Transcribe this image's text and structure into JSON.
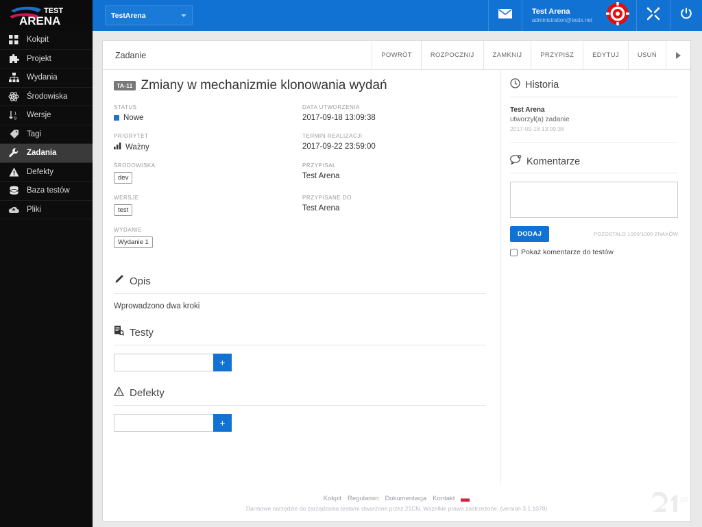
{
  "brand": {
    "logo_top": "TEST",
    "logo_bottom": "ARENA"
  },
  "colors": {
    "accent": "#1272d3",
    "sidebar_bg": "#0d0d0d",
    "status_blue": "#1e73c8",
    "badge_gray": "#777777"
  },
  "topbar": {
    "project_select": "TestArena",
    "user_name": "Test Arena",
    "user_email": "administration@testx.net",
    "icons": [
      "mail-icon",
      "brand-target-icon",
      "tools-icon",
      "power-icon"
    ]
  },
  "sidebar": {
    "items": [
      {
        "label": "Kokpit",
        "icon": "dashboard-icon",
        "active": false
      },
      {
        "label": "Projekt",
        "icon": "puzzle-icon",
        "active": false
      },
      {
        "label": "Wydania",
        "icon": "sitemap-icon",
        "active": false
      },
      {
        "label": "Środowiska",
        "icon": "atom-icon",
        "active": false
      },
      {
        "label": "Wersje",
        "icon": "sort-numeric-icon",
        "active": false
      },
      {
        "label": "Tagi",
        "icon": "tag-icon",
        "active": false
      },
      {
        "label": "Zadania",
        "icon": "wrench-icon",
        "active": true
      },
      {
        "label": "Defekty",
        "icon": "warning-icon",
        "active": false
      },
      {
        "label": "Baza testów",
        "icon": "database-icon",
        "active": false
      },
      {
        "label": "Pliki",
        "icon": "cloud-icon",
        "active": false
      }
    ]
  },
  "action_bar": {
    "title": "Zadanie",
    "buttons": [
      {
        "label": "POWRÓT",
        "name": "back-button"
      },
      {
        "label": "ROZPOCZNIJ",
        "name": "start-button"
      },
      {
        "label": "ZAMKNIJ",
        "name": "close-button"
      },
      {
        "label": "PRZYPISZ",
        "name": "assign-button"
      },
      {
        "label": "EDYTUJ",
        "name": "edit-button"
      },
      {
        "label": "USUŃ",
        "name": "delete-button"
      }
    ],
    "more": "more-actions-arrow-icon"
  },
  "issue": {
    "id_badge": "TA-11",
    "title": "Zmiany w mechanizmie klonowania wydań",
    "fields_left": [
      {
        "label": "STATUS",
        "value": "Nowe",
        "kind": "status"
      },
      {
        "label": "PRIORYTET",
        "value": "Ważny",
        "kind": "priority"
      },
      {
        "label": "ŚRODOWISKA",
        "value": "dev",
        "kind": "chip"
      },
      {
        "label": "WERSJE",
        "value": "test",
        "kind": "chip"
      },
      {
        "label": "WYDANIE",
        "value": "Wydanie 1",
        "kind": "chip"
      }
    ],
    "fields_right": [
      {
        "label": "DATA UTWORZENIA",
        "value": "2017-09-18 13:09:38",
        "kind": "text"
      },
      {
        "label": "TERMIN REALIZACJI",
        "value": "2017-09-22 23:59:00",
        "kind": "text"
      },
      {
        "label": "PRZYPISAŁ",
        "value": "Test Arena",
        "kind": "text"
      },
      {
        "label": "PRZYPISANE DO",
        "value": "Test Arena",
        "kind": "text"
      }
    ]
  },
  "sections": {
    "description": {
      "title": "Opis",
      "icon": "pencil-icon",
      "text": "Wprowadzono dwa kroki"
    },
    "tests": {
      "title": "Testy",
      "icon": "test-list-icon",
      "input_value": "",
      "add_label": "+"
    },
    "defects": {
      "title": "Defekty",
      "icon": "warning-triangle-icon",
      "input_value": "",
      "add_label": "+"
    }
  },
  "history": {
    "title": "Historia",
    "icon": "clock-icon",
    "entries": [
      {
        "who": "Test Arena",
        "action": "utworzył(a) zadanie",
        "when": "2017-09-18 13:09:38"
      }
    ]
  },
  "comments": {
    "title": "Komentarze",
    "icon": "comment-icon",
    "textarea_value": "",
    "add_label": "DODAJ",
    "counter": "POZOSTAŁO 1000/1000 ZNAKÓW",
    "checkbox_label": "Pokaż komentarze do testów",
    "checkbox_checked": false
  },
  "footer": {
    "links": [
      "Kokpit",
      "Regulamin",
      "Dokumentacja",
      "Kontakt"
    ],
    "flag": "polish-flag-icon",
    "copyright": "Darmowe narzędzie do zarządzania testami stworzone przez 21CN. Wszelkie prawa zastrzeżone. (version 3.1.1078)",
    "watermark": "21CN"
  }
}
